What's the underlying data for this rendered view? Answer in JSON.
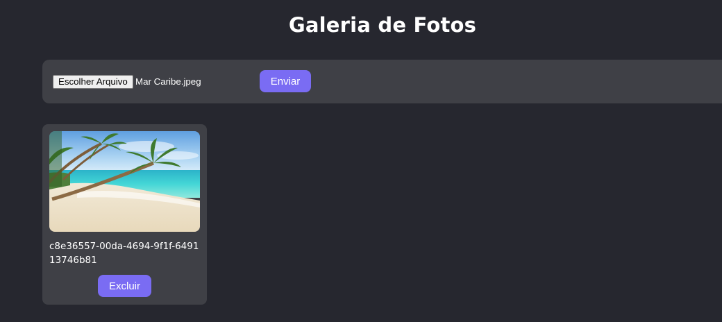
{
  "header": {
    "title": "Galeria de Fotos"
  },
  "upload": {
    "choose_file_label": "Escolher Arquivo",
    "selected_file": "Mar Caribe.jpeg",
    "send_label": "Enviar"
  },
  "gallery": {
    "items": [
      {
        "id": "c8e36557-00da-4694-9f1f-649113746b81",
        "delete_label": "Excluir"
      }
    ]
  },
  "colors": {
    "background": "#26272f",
    "panel": "#3f4046",
    "accent": "#7a6cf3"
  }
}
